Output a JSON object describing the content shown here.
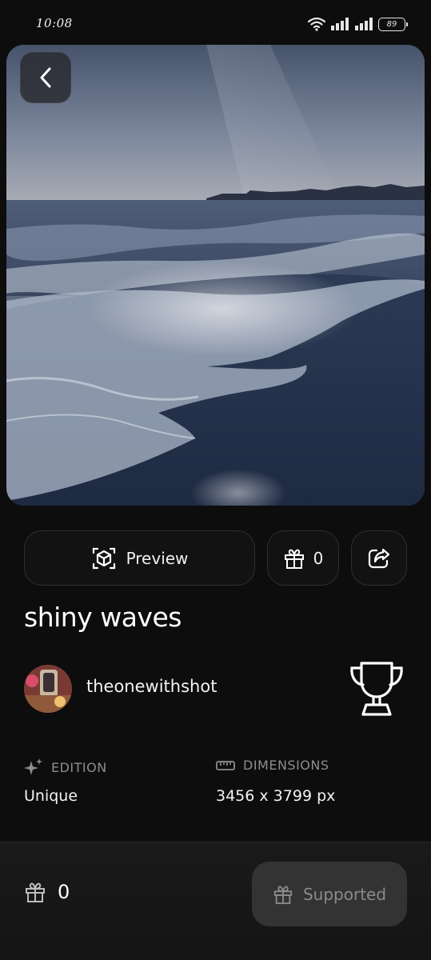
{
  "status_bar": {
    "time": "10:08",
    "battery": "89",
    "icons": [
      "wifi-icon",
      "signal-icon",
      "signal-icon",
      "battery-icon"
    ]
  },
  "artwork": {
    "title": "shiny waves",
    "image_description_icon": "photo",
    "author": "theonewithshot"
  },
  "actions": {
    "preview_label": "Preview",
    "gift_count": "0"
  },
  "meta": {
    "edition_label": "EDITION",
    "edition_value": "Unique",
    "dimensions_label": "DIMENSIONS",
    "dimensions_value": "3456 x 3799 px"
  },
  "bottom_bar": {
    "gift_count": "0",
    "supported_label": "Supported"
  },
  "colors": {
    "background": "#0d0d0d",
    "button_border": "#2f2f2f",
    "muted_text": "#8d8d8d",
    "supported_bg": "#333333"
  }
}
